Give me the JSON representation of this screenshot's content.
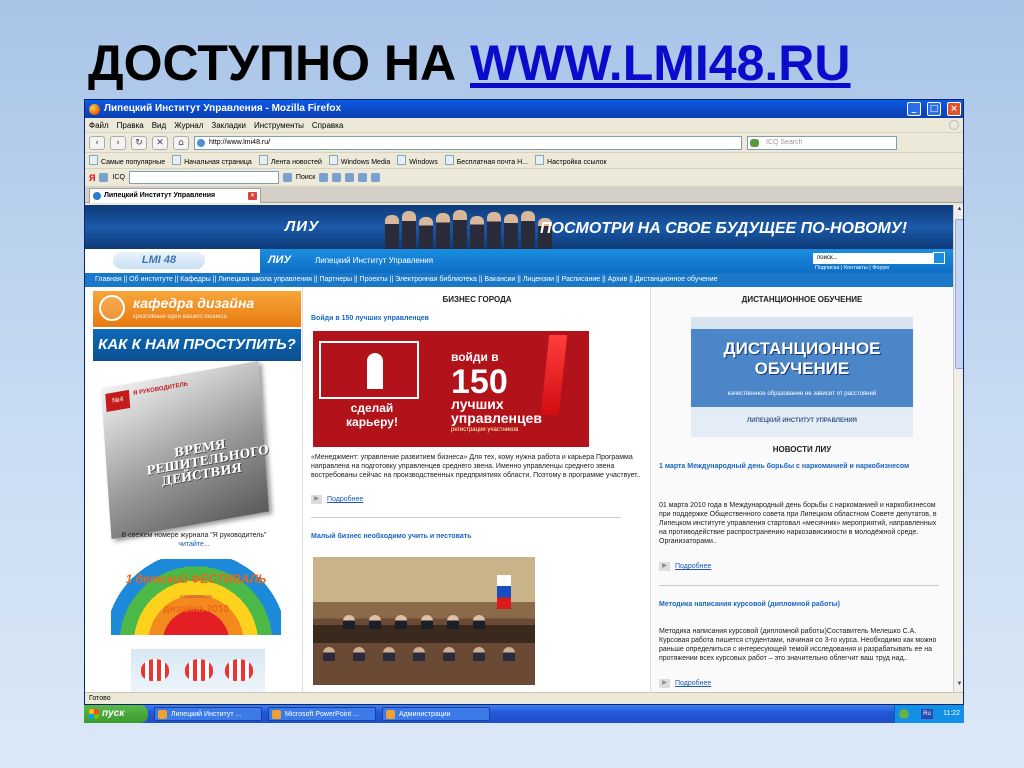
{
  "slide": {
    "title_prefix": "ДОСТУПНО НА",
    "title_link": "WWW.LMI48.RU"
  },
  "window": {
    "title": "Липецкий Институт Управления - Mozilla Firefox",
    "controls": [
      "_",
      "□",
      "×"
    ]
  },
  "menu": [
    "Файл",
    "Правка",
    "Вид",
    "Журнал",
    "Закладки",
    "Инструменты",
    "Справка"
  ],
  "nav": {
    "back": "‹",
    "forward": "›",
    "reload": "↻",
    "stop": "✕",
    "home": "⌂",
    "url": "http://www.lmi48.ru/",
    "search_placeholder": "ICQ Search"
  },
  "bookmarks": [
    "Самые популярные",
    "Начальная страница",
    "Лента новостей",
    "Windows Media",
    "Windows",
    "Бесплатная почта H...",
    "Настройка ссылок"
  ],
  "yandex_bar": {
    "logo": "Я",
    "icq": "ICQ",
    "search": "Поиск"
  },
  "tab": {
    "label": "Липецкий Институт Управления",
    "close": "×"
  },
  "site": {
    "banner_logo": "ЛИУ",
    "slogan": "ПОСМОТРИ НА СВОЕ БУДУЩЕЕ ПО-НОВОМУ!",
    "lmi_badge": "LMI 48",
    "header_logo": "ЛИУ",
    "header_name": "Липецкий Институт Управления",
    "search_placeholder": "поиск...",
    "top_links": "Подписка | Контакты | Форум",
    "navlinks": "Главная || Об институте || Кафедры || Липецкая школа управления || Партнеры || Проекты || Электронная библиотека || Вакансии || Лицензии || Расписание || Архив || Дистанционное обучение"
  },
  "left": {
    "kafedra_title": "кафедра дизайна",
    "kafedra_sub": "креативные идеи вашего бизнеса",
    "kak_title": "КАК К НАМ ПРОСТУПИТЬ?",
    "mag_number": "№4",
    "mag_brand": "Я РУКОВОДИТЕЛЬ",
    "mag_cover": "ВРЕМЯ РЕШИТЕЛЬНОГО ДЕЙСТВИЯ",
    "caption": "В свежем номере журнала \"Я руководитель\"",
    "read_link": "читайте...",
    "fest_line1": "1 детский ФЕСТИВАЛЬ",
    "fest_small": "современного",
    "fest_line2": "дизайна 2010"
  },
  "middle": {
    "section_title": "БИЗНЕС ГОРОДА",
    "article1_title": "Войди в 150 лучших управленцев",
    "promo_left": "сделай карьеру!",
    "promo_line1": "войди в",
    "promo_line2": "150",
    "promo_line3": "лучших управленцев",
    "promo_line4": "регистрация участников",
    "article1_text": "«Менеджмент: управление развитием бизнеса» Для тех, кому нужна работа и карьера Программа направлена на подготовку управленцев среднего звена. Именно управленцы среднего звена востребованы сейчас на производственных предприятиях области. Поэтому в программе участвует..",
    "more": "Подробнее",
    "article2_title": "Малый бизнес необходимо учить и пестовать"
  },
  "right": {
    "section_title": "ДИСТАНЦИОННОЕ ОБУЧЕНИЕ",
    "dist_title": "ДИСТАНЦИОННОЕ ОБУЧЕНИЕ",
    "dist_sub": "качественное образование не зависит от расстояний",
    "dist_logo": "ЛИПЕЦКИЙ ИНСТИТУТ УПРАВЛЕНИЯ",
    "news_title": "НОВОСТИ ЛИУ",
    "news1_title": "1 марта Международный день борьбы с наркоманией и наркобизнесом",
    "news1_text": "01 марта 2010 года в Международный день борьбы с наркоманией и наркобизнесом при поддержке Общественного совета при Липецком областном Совете депутатов, в Липецком институте управления стартовал «месячник» мероприятий, направленных на противодействие распространению наркозависимости в молодёжной среде. Организаторами..",
    "more1": "Подробнее",
    "news2_title": "Методика написания курсовой (дипломной работы)",
    "news2_text": "Методика написания курсовой (дипломной работы)Составитель Мелешко С.А. Курсовая работа пишется студентами, начиная со 3-го курса. Необходимо как можно раньше определиться с интересующей темой исследования и разрабатывать ее на протяжении всех курсовых работ – это значительно облегчит ваш труд над..",
    "more2": "Подробнее"
  },
  "status": "Готово",
  "taskbar": {
    "start": "пуск",
    "tasks": [
      "Липецкий Институт ...",
      "Microsoft PowerPoint ...",
      "Администрации"
    ],
    "lang": "Ru",
    "clock": "11:22"
  }
}
